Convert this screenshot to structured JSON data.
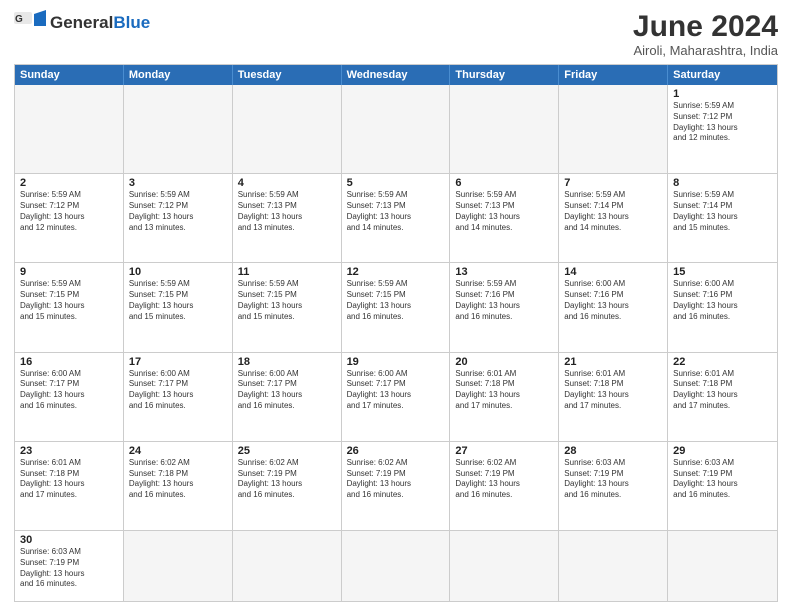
{
  "logo": {
    "text_general": "General",
    "text_blue": "Blue"
  },
  "header": {
    "month_title": "June 2024",
    "subtitle": "Airoli, Maharashtra, India"
  },
  "weekdays": [
    "Sunday",
    "Monday",
    "Tuesday",
    "Wednesday",
    "Thursday",
    "Friday",
    "Saturday"
  ],
  "weeks": [
    [
      {
        "day": "",
        "empty": true
      },
      {
        "day": "",
        "empty": true
      },
      {
        "day": "",
        "empty": true
      },
      {
        "day": "",
        "empty": true
      },
      {
        "day": "",
        "empty": true
      },
      {
        "day": "",
        "empty": true
      },
      {
        "day": "1",
        "info": "Sunrise: 5:59 AM\nSunset: 7:12 PM\nDaylight: 13 hours\nand 12 minutes."
      }
    ],
    [
      {
        "day": "2",
        "info": "Sunrise: 5:59 AM\nSunset: 7:12 PM\nDaylight: 13 hours\nand 12 minutes."
      },
      {
        "day": "3",
        "info": "Sunrise: 5:59 AM\nSunset: 7:12 PM\nDaylight: 13 hours\nand 13 minutes."
      },
      {
        "day": "4",
        "info": "Sunrise: 5:59 AM\nSunset: 7:13 PM\nDaylight: 13 hours\nand 13 minutes."
      },
      {
        "day": "5",
        "info": "Sunrise: 5:59 AM\nSunset: 7:13 PM\nDaylight: 13 hours\nand 14 minutes."
      },
      {
        "day": "6",
        "info": "Sunrise: 5:59 AM\nSunset: 7:13 PM\nDaylight: 13 hours\nand 14 minutes."
      },
      {
        "day": "7",
        "info": "Sunrise: 5:59 AM\nSunset: 7:14 PM\nDaylight: 13 hours\nand 14 minutes."
      },
      {
        "day": "8",
        "info": "Sunrise: 5:59 AM\nSunset: 7:14 PM\nDaylight: 13 hours\nand 15 minutes."
      }
    ],
    [
      {
        "day": "9",
        "info": "Sunrise: 5:59 AM\nSunset: 7:15 PM\nDaylight: 13 hours\nand 15 minutes."
      },
      {
        "day": "10",
        "info": "Sunrise: 5:59 AM\nSunset: 7:15 PM\nDaylight: 13 hours\nand 15 minutes."
      },
      {
        "day": "11",
        "info": "Sunrise: 5:59 AM\nSunset: 7:15 PM\nDaylight: 13 hours\nand 15 minutes."
      },
      {
        "day": "12",
        "info": "Sunrise: 5:59 AM\nSunset: 7:15 PM\nDaylight: 13 hours\nand 16 minutes."
      },
      {
        "day": "13",
        "info": "Sunrise: 5:59 AM\nSunset: 7:16 PM\nDaylight: 13 hours\nand 16 minutes."
      },
      {
        "day": "14",
        "info": "Sunrise: 6:00 AM\nSunset: 7:16 PM\nDaylight: 13 hours\nand 16 minutes."
      },
      {
        "day": "15",
        "info": "Sunrise: 6:00 AM\nSunset: 7:16 PM\nDaylight: 13 hours\nand 16 minutes."
      }
    ],
    [
      {
        "day": "16",
        "info": "Sunrise: 6:00 AM\nSunset: 7:17 PM\nDaylight: 13 hours\nand 16 minutes."
      },
      {
        "day": "17",
        "info": "Sunrise: 6:00 AM\nSunset: 7:17 PM\nDaylight: 13 hours\nand 16 minutes."
      },
      {
        "day": "18",
        "info": "Sunrise: 6:00 AM\nSunset: 7:17 PM\nDaylight: 13 hours\nand 16 minutes."
      },
      {
        "day": "19",
        "info": "Sunrise: 6:00 AM\nSunset: 7:17 PM\nDaylight: 13 hours\nand 17 minutes."
      },
      {
        "day": "20",
        "info": "Sunrise: 6:01 AM\nSunset: 7:18 PM\nDaylight: 13 hours\nand 17 minutes."
      },
      {
        "day": "21",
        "info": "Sunrise: 6:01 AM\nSunset: 7:18 PM\nDaylight: 13 hours\nand 17 minutes."
      },
      {
        "day": "22",
        "info": "Sunrise: 6:01 AM\nSunset: 7:18 PM\nDaylight: 13 hours\nand 17 minutes."
      }
    ],
    [
      {
        "day": "23",
        "info": "Sunrise: 6:01 AM\nSunset: 7:18 PM\nDaylight: 13 hours\nand 17 minutes."
      },
      {
        "day": "24",
        "info": "Sunrise: 6:02 AM\nSunset: 7:18 PM\nDaylight: 13 hours\nand 16 minutes."
      },
      {
        "day": "25",
        "info": "Sunrise: 6:02 AM\nSunset: 7:19 PM\nDaylight: 13 hours\nand 16 minutes."
      },
      {
        "day": "26",
        "info": "Sunrise: 6:02 AM\nSunset: 7:19 PM\nDaylight: 13 hours\nand 16 minutes."
      },
      {
        "day": "27",
        "info": "Sunrise: 6:02 AM\nSunset: 7:19 PM\nDaylight: 13 hours\nand 16 minutes."
      },
      {
        "day": "28",
        "info": "Sunrise: 6:03 AM\nSunset: 7:19 PM\nDaylight: 13 hours\nand 16 minutes."
      },
      {
        "day": "29",
        "info": "Sunrise: 6:03 AM\nSunset: 7:19 PM\nDaylight: 13 hours\nand 16 minutes."
      }
    ],
    [
      {
        "day": "30",
        "info": "Sunrise: 6:03 AM\nSunset: 7:19 PM\nDaylight: 13 hours\nand 16 minutes."
      },
      {
        "day": "",
        "empty": true
      },
      {
        "day": "",
        "empty": true
      },
      {
        "day": "",
        "empty": true
      },
      {
        "day": "",
        "empty": true
      },
      {
        "day": "",
        "empty": true
      },
      {
        "day": "",
        "empty": true
      }
    ]
  ]
}
